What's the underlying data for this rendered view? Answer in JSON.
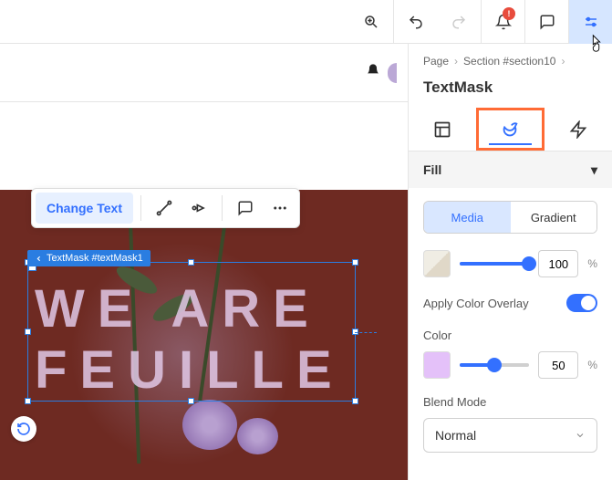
{
  "topbar": {
    "notification_badge": "!"
  },
  "toolbar": {
    "change_text": "Change Text"
  },
  "selection": {
    "label": "TextMask #textMask1",
    "text_line1": "WE ARE",
    "text_line2": "FEUILLE"
  },
  "breadcrumb": {
    "page": "Page",
    "section": "Section #section10"
  },
  "panel": {
    "title": "TextMask",
    "fill_header": "Fill",
    "fill_tabs": {
      "media": "Media",
      "gradient": "Gradient"
    },
    "opacity_value": "100",
    "apply_overlay_label": "Apply Color Overlay",
    "color_label": "Color",
    "color_value": "50",
    "blend_label": "Blend Mode",
    "blend_value": "Normal",
    "pct": "%"
  }
}
